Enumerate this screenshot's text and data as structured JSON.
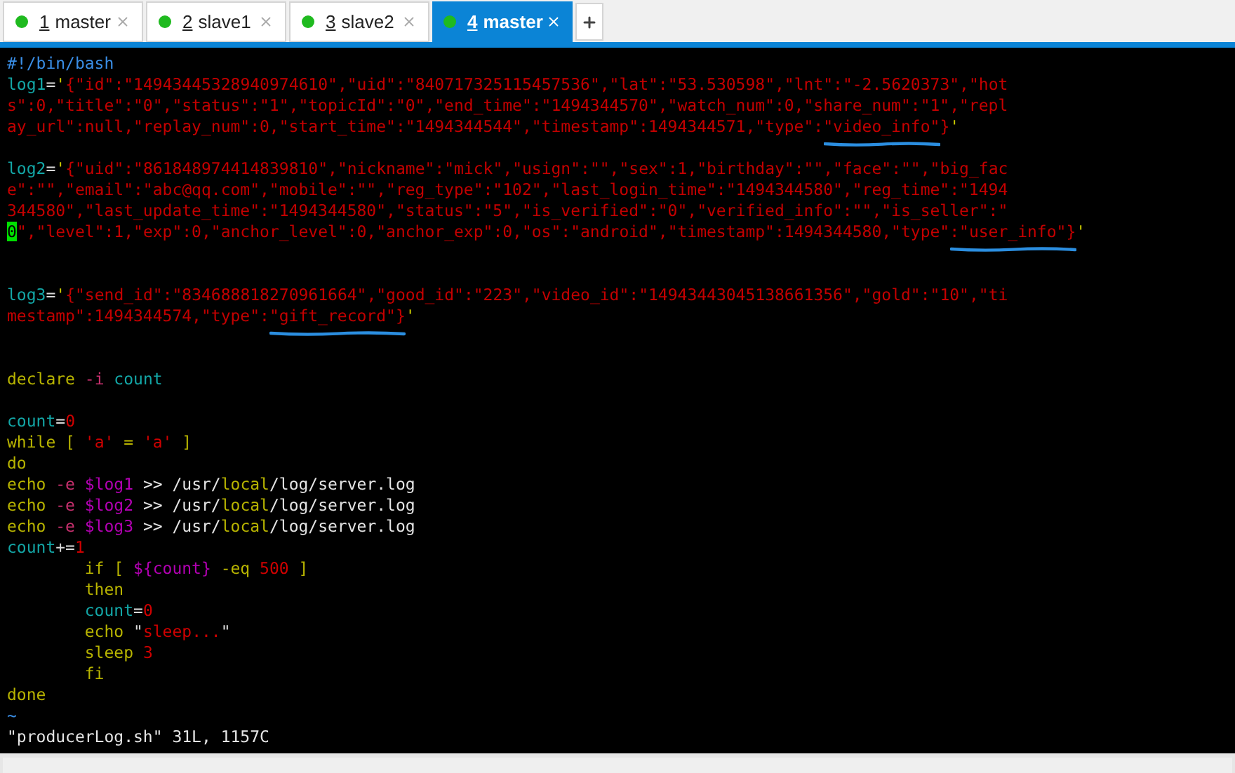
{
  "tabs": [
    {
      "number": "1",
      "label": "master",
      "selected": false
    },
    {
      "number": "2",
      "label": "slave1",
      "selected": false
    },
    {
      "number": "3",
      "label": "slave2",
      "selected": false
    },
    {
      "number": "4",
      "label": "master",
      "selected": true
    }
  ],
  "editor": {
    "lines": [
      {
        "kind": "code",
        "segments": [
          {
            "t": "#!/bin/bash",
            "kind": "comment"
          }
        ]
      },
      {
        "kind": "code",
        "segments": [
          {
            "t": "log1",
            "kind": "var"
          },
          {
            "t": "=",
            "kind": "op"
          },
          {
            "t": "'",
            "kind": "quote"
          },
          {
            "t": "{\"id\":\"14943445328940974610\",\"uid\":\"840717325115457536\",\"lat\":\"53.530598\",\"lnt\":\"-2.5620373\",\"hot",
            "kind": "string"
          }
        ]
      },
      {
        "kind": "code",
        "segments": [
          {
            "t": "s\":0,\"title\":\"0\",\"status\":\"1\",\"topicId\":\"0\",\"end_time\":\"1494344570\",\"watch_num\":0,\"share_num\":\"1\",\"repl",
            "kind": "string"
          }
        ]
      },
      {
        "kind": "code",
        "segments": [
          {
            "t": "ay_url\":null,\"replay_num\":0,\"start_time\":\"1494344544\",\"timestamp\":1494344571,\"type\":",
            "kind": "string"
          },
          {
            "t": "\"video_info\"",
            "kind": "string",
            "marked": true
          },
          {
            "t": "}",
            "kind": "string"
          },
          {
            "t": "'",
            "kind": "quote"
          }
        ]
      },
      {
        "kind": "blank"
      },
      {
        "kind": "code",
        "segments": [
          {
            "t": "log2",
            "kind": "var"
          },
          {
            "t": "=",
            "kind": "op"
          },
          {
            "t": "'",
            "kind": "quote"
          },
          {
            "t": "{\"uid\":\"861848974414839810\",\"nickname\":\"mick\",\"usign\":\"\",\"sex\":1,\"birthday\":\"\",\"face\":\"\",\"big_fac",
            "kind": "string"
          }
        ]
      },
      {
        "kind": "code",
        "segments": [
          {
            "t": "e\":\"\",\"email\":\"abc@qq.com\",\"mobile\":\"\",\"reg_type\":\"102\",\"last_login_time\":\"1494344580\",\"reg_time\":\"1494",
            "kind": "string"
          }
        ]
      },
      {
        "kind": "code",
        "segments": [
          {
            "t": "344580\",\"last_update_time\":\"1494344580\",\"status\":\"5\",\"is_verified\":\"0\",\"verified_info\":\"\",\"is_seller\":\"",
            "kind": "string"
          }
        ]
      },
      {
        "kind": "code",
        "segments": [
          {
            "t": "0",
            "kind": "cursor"
          },
          {
            "t": "\",\"level\":1,\"exp\":0,\"anchor_level\":0,\"anchor_exp\":0,\"os\":\"android\",\"timestamp\":1494344580,\"type\"",
            "kind": "string"
          },
          {
            "t": ":\"user_info\"}",
            "kind": "string",
            "marked": true
          },
          {
            "t": "'",
            "kind": "quote"
          }
        ]
      },
      {
        "kind": "blank"
      },
      {
        "kind": "blank"
      },
      {
        "kind": "code",
        "segments": [
          {
            "t": "log3",
            "kind": "var"
          },
          {
            "t": "=",
            "kind": "op"
          },
          {
            "t": "'",
            "kind": "quote"
          },
          {
            "t": "{\"send_id\":\"834688818270961664\",\"good_id\":\"223\",\"video_id\":\"14943443045138661356\",\"gold\":\"10\",\"ti",
            "kind": "string"
          }
        ]
      },
      {
        "kind": "code",
        "segments": [
          {
            "t": "mestamp\":1494344574,\"type\":",
            "kind": "string"
          },
          {
            "t": "\"gift_record\"}",
            "kind": "string",
            "marked": true
          },
          {
            "t": "'",
            "kind": "quote"
          }
        ]
      },
      {
        "kind": "blank"
      },
      {
        "kind": "blank"
      },
      {
        "kind": "code",
        "segments": [
          {
            "t": "declare ",
            "kind": "keyword"
          },
          {
            "t": "-i ",
            "kind": "flag"
          },
          {
            "t": "count",
            "kind": "var"
          }
        ]
      },
      {
        "kind": "blank"
      },
      {
        "kind": "code",
        "segments": [
          {
            "t": "count",
            "kind": "var"
          },
          {
            "t": "=",
            "kind": "op"
          },
          {
            "t": "0",
            "kind": "number"
          }
        ]
      },
      {
        "kind": "code",
        "segments": [
          {
            "t": "while [ ",
            "kind": "keyword"
          },
          {
            "t": "'a'",
            "kind": "number"
          },
          {
            "t": " = ",
            "kind": "keyword"
          },
          {
            "t": "'a'",
            "kind": "number"
          },
          {
            "t": " ]",
            "kind": "keyword"
          }
        ]
      },
      {
        "kind": "code",
        "segments": [
          {
            "t": "do",
            "kind": "keyword"
          }
        ]
      },
      {
        "kind": "code",
        "segments": [
          {
            "t": "echo ",
            "kind": "keyword"
          },
          {
            "t": "-e ",
            "kind": "flag"
          },
          {
            "t": "$log1",
            "kind": "dollar"
          },
          {
            "t": " >> /usr/",
            "kind": "path"
          },
          {
            "t": "local",
            "kind": "keyword"
          },
          {
            "t": "/log/server.log",
            "kind": "path"
          }
        ]
      },
      {
        "kind": "code",
        "segments": [
          {
            "t": "echo ",
            "kind": "keyword"
          },
          {
            "t": "-e ",
            "kind": "flag"
          },
          {
            "t": "$log2",
            "kind": "dollar"
          },
          {
            "t": " >> /usr/",
            "kind": "path"
          },
          {
            "t": "local",
            "kind": "keyword"
          },
          {
            "t": "/log/server.log",
            "kind": "path"
          }
        ]
      },
      {
        "kind": "code",
        "segments": [
          {
            "t": "echo ",
            "kind": "keyword"
          },
          {
            "t": "-e ",
            "kind": "flag"
          },
          {
            "t": "$log3",
            "kind": "dollar"
          },
          {
            "t": " >> /usr/",
            "kind": "path"
          },
          {
            "t": "local",
            "kind": "keyword"
          },
          {
            "t": "/log/server.log",
            "kind": "path"
          }
        ]
      },
      {
        "kind": "code",
        "segments": [
          {
            "t": "count",
            "kind": "var"
          },
          {
            "t": "+=",
            "kind": "op"
          },
          {
            "t": "1",
            "kind": "number"
          }
        ]
      },
      {
        "kind": "code",
        "segments": [
          {
            "t": "        if [ ",
            "kind": "keyword"
          },
          {
            "t": "${count}",
            "kind": "dollar"
          },
          {
            "t": " -eq ",
            "kind": "keyword"
          },
          {
            "t": "500",
            "kind": "number"
          },
          {
            "t": " ]",
            "kind": "keyword"
          }
        ]
      },
      {
        "kind": "code",
        "segments": [
          {
            "t": "        then",
            "kind": "keyword"
          }
        ]
      },
      {
        "kind": "code",
        "segments": [
          {
            "t": "        count",
            "kind": "var"
          },
          {
            "t": "=",
            "kind": "op"
          },
          {
            "t": "0",
            "kind": "number"
          }
        ]
      },
      {
        "kind": "code",
        "segments": [
          {
            "t": "        echo ",
            "kind": "keyword"
          },
          {
            "t": "\"",
            "kind": "op"
          },
          {
            "t": "sleep...",
            "kind": "number"
          },
          {
            "t": "\"",
            "kind": "op"
          }
        ]
      },
      {
        "kind": "code",
        "segments": [
          {
            "t": "        sleep ",
            "kind": "keyword"
          },
          {
            "t": "3",
            "kind": "number"
          }
        ]
      },
      {
        "kind": "code",
        "segments": [
          {
            "t": "        fi",
            "kind": "keyword"
          }
        ]
      },
      {
        "kind": "code",
        "segments": [
          {
            "t": "done",
            "kind": "keyword"
          }
        ]
      },
      {
        "kind": "code",
        "segments": [
          {
            "t": "~",
            "kind": "comment"
          }
        ]
      },
      {
        "kind": "status",
        "segments": [
          {
            "t": "\"producerLog.sh\" 31L, 1157C",
            "kind": "path"
          }
        ]
      }
    ]
  }
}
